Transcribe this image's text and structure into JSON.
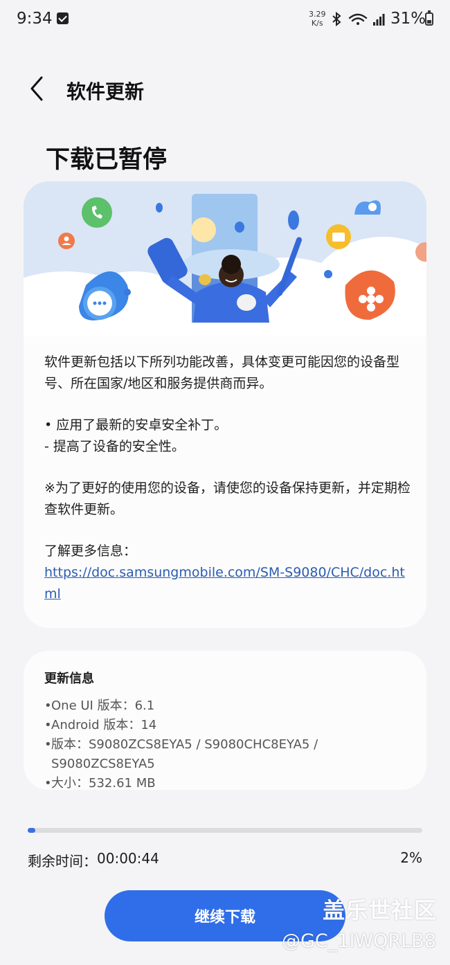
{
  "status_bar": {
    "time": "9:34",
    "speed_value": "3.29",
    "speed_unit": "K/s",
    "battery": "31%",
    "icons": [
      "checkbox-notification-icon",
      "bluetooth-icon",
      "wifi-icon",
      "signal-icon",
      "battery-icon"
    ],
    "battery_level": 0.31
  },
  "header": {
    "back_icon": "back-arrow-icon",
    "title": "软件更新"
  },
  "page": {
    "title": "下载已暂停"
  },
  "release_notes": {
    "intro": "软件更新包括以下所列功能改善，具体变更可能因您的设备型号、所在国家/地区和服务提供商而异。",
    "bullet_1": "• 应用了最新的安卓安全补丁。",
    "bullet_1_sub": " - 提高了设备的安全性。",
    "notice": "※为了更好的使用您的设备，请使您的设备保持更新，并定期检查软件更新。",
    "more_info_label": "了解更多信息：",
    "link": "https://doc.samsungmobile.com/SM-S9080/CHC/doc.html"
  },
  "update_info": {
    "title": "更新信息",
    "items": [
      "One UI 版本：6.1",
      "Android 版本：14",
      "版本：S9080ZCS8EYA5 / S9080CHC8EYA5 / S9080ZCS8EYA5",
      "大小：532.61 MB"
    ]
  },
  "download": {
    "remaining_label": "剩余时间：",
    "remaining_time": "00:00:44",
    "percent_text": "2%",
    "progress": 0.02
  },
  "actions": {
    "continue_label": "继续下载"
  },
  "watermark": {
    "line1": "盖乐世社区",
    "line2": "@GC_1IWQRLB8"
  },
  "colors": {
    "accent": "#2f6ee8",
    "background": "#f4f4f6",
    "card": "#fcfcfd",
    "link": "#2b5cb0"
  }
}
